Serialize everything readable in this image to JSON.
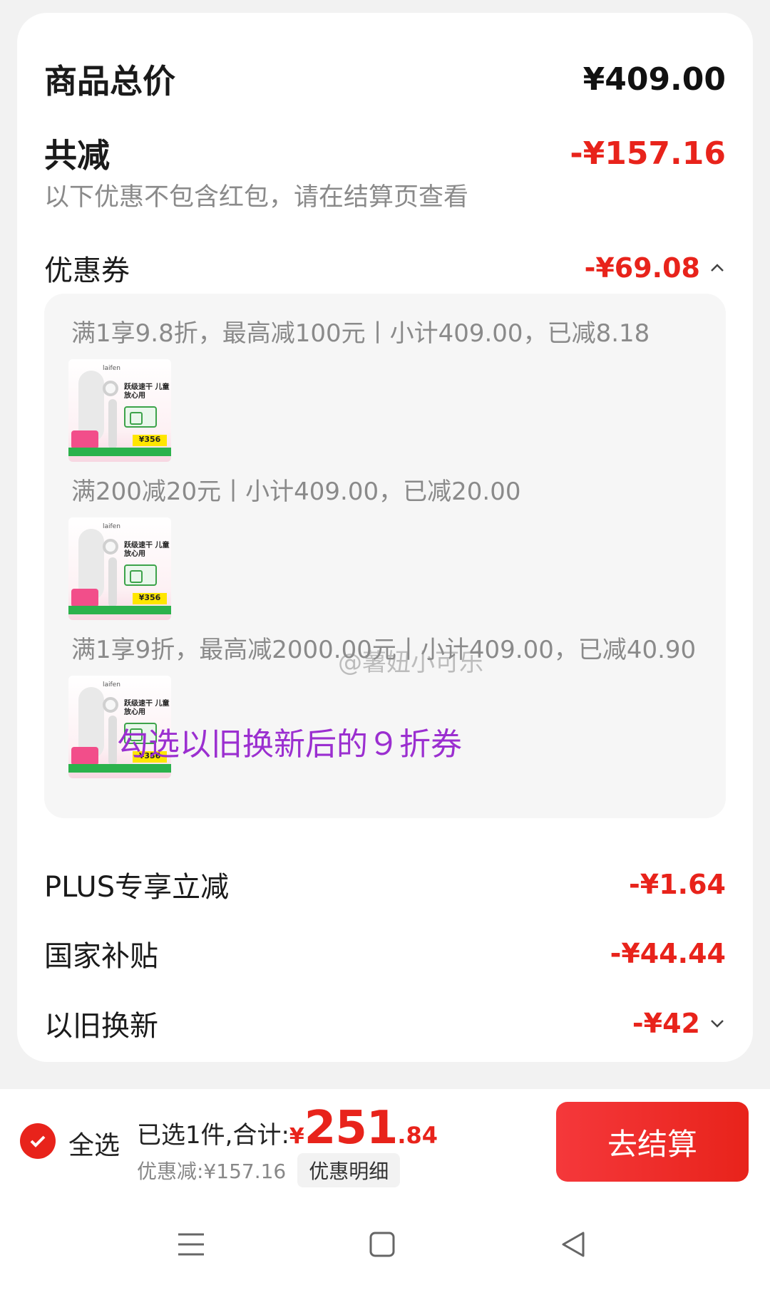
{
  "summary": {
    "total_label": "商品总价",
    "total_amount": "¥409.00",
    "reduce_label": "共减",
    "reduce_amount": "-¥157.16",
    "note": "以下优惠不包含红包，请在结算页查看"
  },
  "coupon": {
    "label": "优惠券",
    "amount": "-¥69.08",
    "items": [
      {
        "text": "满1享9.8折，最高减100元丨小计409.00，已减8.18"
      },
      {
        "text": "满200减20元丨小计409.00，已减20.00"
      },
      {
        "text": "满1享9折，最高减2000.00元丨小计409.00，已减40.90"
      }
    ],
    "thumb": {
      "brand": "laifen",
      "caption": "跃级速干 儿童放心用",
      "price": "¥356"
    },
    "annotation": "勾选以旧换新后的９折券",
    "watermark": "@薯妞小可乐"
  },
  "discounts": [
    {
      "label": "PLUS专享立减",
      "amount": "-¥1.64"
    },
    {
      "label": "国家补贴",
      "amount": "-¥44.44"
    },
    {
      "label": "以旧换新",
      "amount": "-¥42"
    }
  ],
  "bottom": {
    "select_all": "全选",
    "sum_label": "已选1件,合计:",
    "currency": "¥",
    "total_int": "251",
    "total_dec": ".84",
    "discount_text": "优惠减:¥157.16",
    "detail_button": "优惠明细",
    "checkout_button": "去结算"
  },
  "colors": {
    "accent": "#e8231b",
    "annotation": "#9b2fd0",
    "card_bg": "#ffffff",
    "page_bg": "#f2f2f2"
  }
}
